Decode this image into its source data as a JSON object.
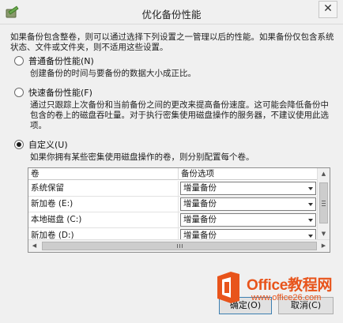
{
  "window": {
    "title": "优化备份性能",
    "close_glyph": "✕"
  },
  "description": "如果备份包含整卷，则可以通过选择下列设置之一管理以后的性能。如果备份仅包含系统状态、文件或文件夹，则不适用这些设置。",
  "options": [
    {
      "label": "普通备份性能(N)",
      "checked": false,
      "description": "创建备份的时间与要备份的数据大小成正比。"
    },
    {
      "label": "快速备份性能(F)",
      "checked": false,
      "description": "通过只跟踪上次备份和当前备份之间的更改来提高备份速度。这可能会降低备份中包含的卷上的磁盘吞吐量。对于执行密集使用磁盘操作的服务器，不建议使用此选项。"
    },
    {
      "label": "自定义(U)",
      "checked": true,
      "description": "如果你拥有某些密集使用磁盘操作的卷，则分别配置每个卷。"
    }
  ],
  "grid": {
    "columns": [
      "卷",
      "备份选项"
    ],
    "rows": [
      {
        "volume": "系统保留",
        "option": "增量备份"
      },
      {
        "volume": "新加卷 (E:)",
        "option": "增量备份"
      },
      {
        "volume": "本地磁盘 (C:)",
        "option": "增量备份"
      },
      {
        "volume": "新加卷 (D:)",
        "option": "增量备份"
      }
    ]
  },
  "buttons": {
    "ok": "确定(O)",
    "cancel": "取消(C)"
  },
  "watermark": {
    "brand": "Office教程网",
    "url": "www.office26.com"
  },
  "colors": {
    "accent": "#3c7fb1",
    "watermark": "#e8541b"
  }
}
